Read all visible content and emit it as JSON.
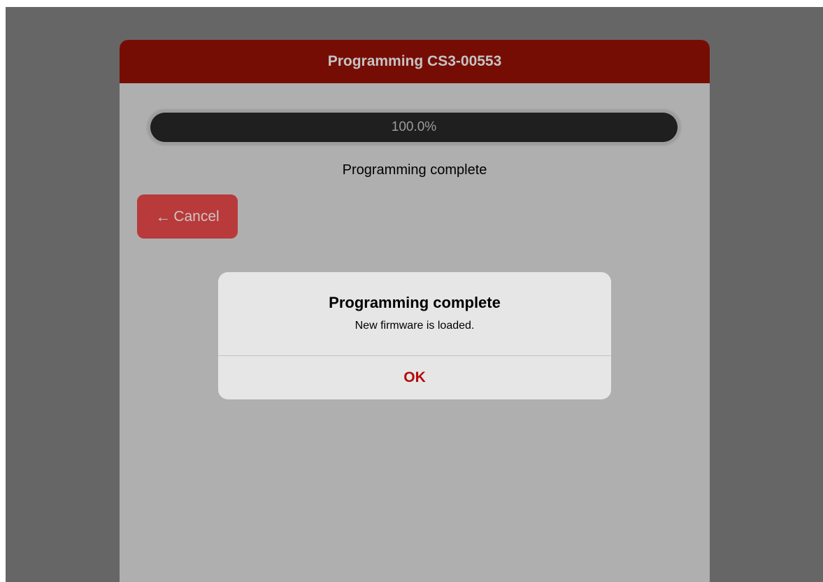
{
  "sheet": {
    "title": "Programming CS3-00553"
  },
  "progress": {
    "fraction": 1.0,
    "label": "100.0%"
  },
  "status": {
    "text": "Programming complete"
  },
  "cancel_button": {
    "icon": "arrow-left-icon",
    "label": "Cancel"
  },
  "alert": {
    "title": "Programming complete",
    "message": "New firmware is loaded.",
    "ok_label": "OK"
  },
  "colors": {
    "header_bg": "#760d04",
    "accent_red": "#b30c0c",
    "cancel_bg": "#b83a3a",
    "backdrop": "#666666",
    "sheet_bg": "#afafaf",
    "alert_bg": "#e6e6e6"
  }
}
